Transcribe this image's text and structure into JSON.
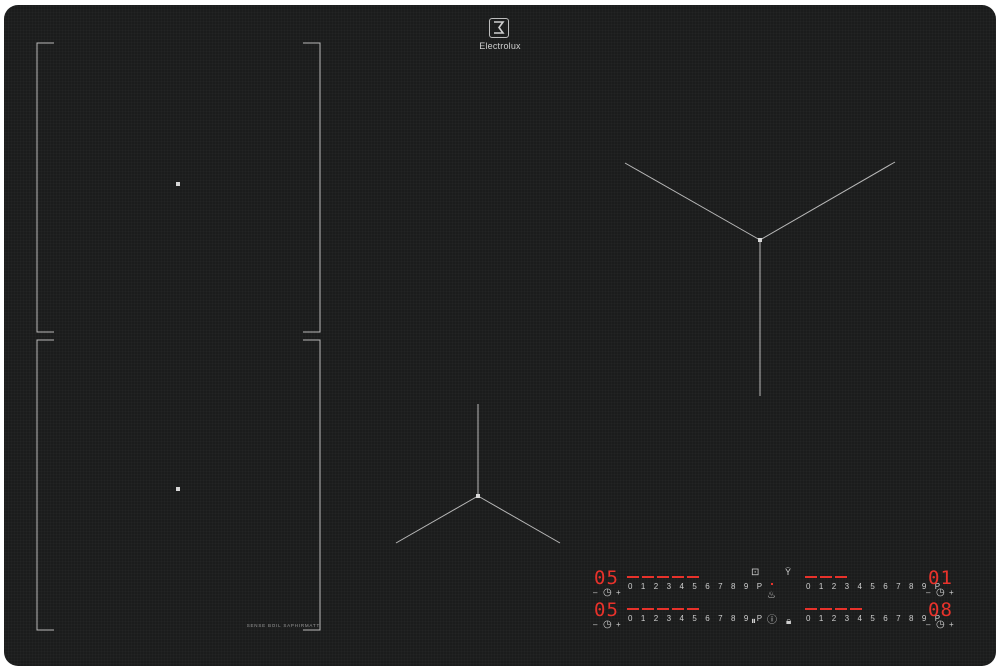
{
  "brand": {
    "name": "Electrolux"
  },
  "zone_label": "SENSE BOIL SAPHIRMATT",
  "controls": {
    "scale": "0 1 2 3 4 5 6 7 8 9 P",
    "minus": "–",
    "plus": "+",
    "timer_icon": "clock-icon",
    "zones": [
      {
        "id": "front-left",
        "display": "05",
        "level_fraction": 0.45
      },
      {
        "id": "rear-left",
        "display": "05",
        "level_fraction": 0.45
      },
      {
        "id": "front-right",
        "display": "01",
        "level_fraction": 0.35
      },
      {
        "id": "rear-right",
        "display": "08",
        "level_fraction": 0.45
      }
    ],
    "center_icons": [
      "hob-link-icon",
      "hood-fan-icon",
      "sense-boil-icon",
      "pause-icon",
      "power-icon",
      "lock-icon"
    ]
  },
  "colors": {
    "surface": "#1b1c1c",
    "display": "#e8322b",
    "markings": "#cfcfcf"
  }
}
